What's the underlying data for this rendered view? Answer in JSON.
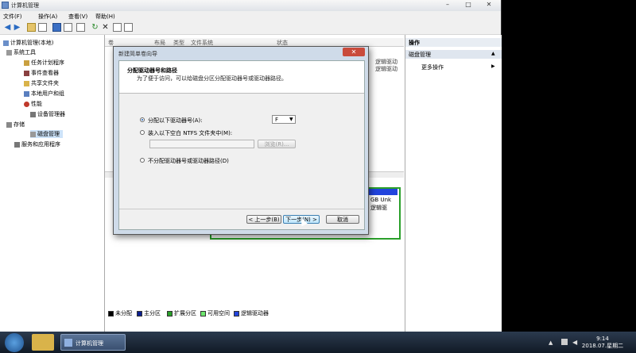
{
  "window": {
    "title": "计算机管理",
    "caption_min": "–",
    "caption_max": "□",
    "caption_close": "✕"
  },
  "menu": [
    "文件(F)",
    "操作(A)",
    "查看(V)",
    "帮助(H)"
  ],
  "tree": {
    "root": "计算机管理(本地)",
    "system_tools": "系统工具",
    "task_scheduler": "任务计划程序",
    "event_viewer": "事件查看器",
    "shared_folders": "共享文件夹",
    "local_users": "本地用户和组",
    "performance": "性能",
    "device_manager": "设备管理器",
    "storage": "存储",
    "disk_management": "磁盘管理",
    "services": "服务和应用程序"
  },
  "columns": [
    "卷",
    "布局",
    "类型",
    "文件系统",
    "状态"
  ],
  "status_snippets": {
    "row1": "逻辑驱动",
    "row2": "逻辑驱动",
    "disk_info": "GB Unk",
    "disk_info2": "逻辑驱"
  },
  "legend": [
    {
      "label": "未分配",
      "color": "#000000"
    },
    {
      "label": "主分区",
      "color": "#0b1f8f"
    },
    {
      "label": "扩展分区",
      "color": "#2a9f2a"
    },
    {
      "label": "可用空间",
      "color": "#6ee66e"
    },
    {
      "label": "逻辑驱动器",
      "color": "#2244dd"
    }
  ],
  "actions": {
    "header": "操作",
    "section": "磁盘管理",
    "more": "更多操作",
    "collapse_arrow": "▲",
    "expand_arrow": "▶"
  },
  "dialog": {
    "title": "新建简单卷向导",
    "heading": "分配驱动器号和路径",
    "subheading": "为了便于访问，可以给磁盘分区分配驱动器号或驱动器路径。",
    "option_letter": "分配以下驱动器号(A):",
    "drive_letter": "F",
    "option_folder": "装入以下空白 NTFS 文件夹中(M):",
    "browse": "浏览(R)...",
    "option_none": "不分配驱动器号或驱动器路径(D)",
    "back": "< 上一步(B)",
    "next": "下一步(N) >",
    "cancel": "取消",
    "close": "✕"
  },
  "taskbar": {
    "active_app": "计算机管理",
    "time": "9:14",
    "date": "2018.07.星期二"
  }
}
